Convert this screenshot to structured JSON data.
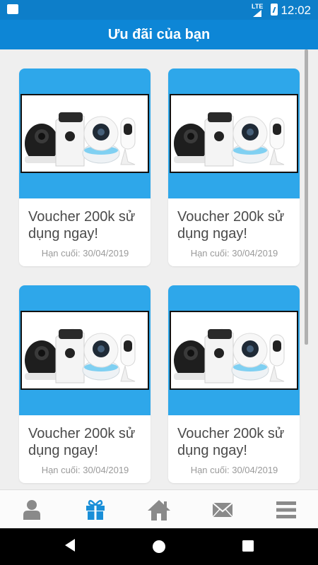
{
  "status_bar": {
    "network": "LTE",
    "time": "12:02"
  },
  "header": {
    "title": "Ưu đãi của bạn"
  },
  "vouchers": [
    {
      "name": "Voucher 200k sử dụng ngay!",
      "deadline": "Hạn cuối: 30/04/2019"
    },
    {
      "name": "Voucher 200k sử dụng ngay!",
      "deadline": "Hạn cuối: 30/04/2019"
    },
    {
      "name": "Voucher 200k sử dụng ngay!",
      "deadline": "Hạn cuối: 30/04/2019"
    },
    {
      "name": "Voucher 200k sử dụng ngay!",
      "deadline": "Hạn cuối: 30/04/2019"
    }
  ],
  "bottom_nav": {
    "items": [
      {
        "icon": "profile-icon",
        "active": false
      },
      {
        "icon": "gift-icon",
        "active": true
      },
      {
        "icon": "home-icon",
        "active": false
      },
      {
        "icon": "mail-icon",
        "active": false
      },
      {
        "icon": "menu-icon",
        "active": false
      }
    ]
  },
  "colors": {
    "primary": "#0d86d6",
    "status_bar": "#0d7ec9",
    "card_banner": "#2ea7ea",
    "nav_active": "#1a8fd8",
    "nav_inactive": "#8a8a8a"
  }
}
